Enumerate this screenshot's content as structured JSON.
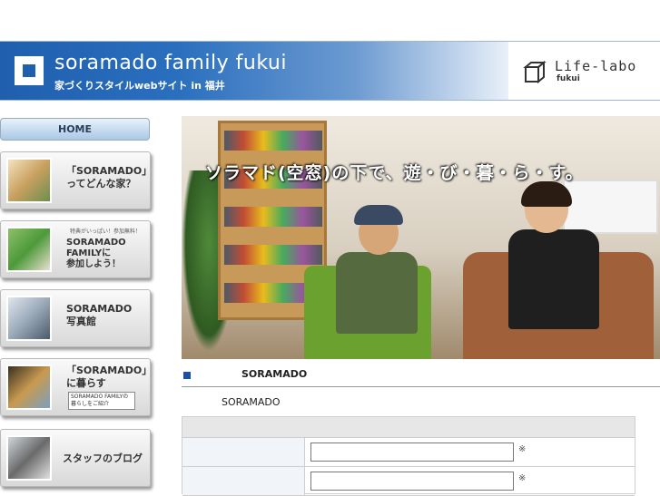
{
  "header": {
    "site_title": "soramado family fukui",
    "site_subtitle": "家づくりスタイルwebサイト in 福井",
    "brand_name": "Life-labo",
    "brand_sub": "fukui"
  },
  "sidebar": {
    "home_label": "HOME",
    "items": [
      {
        "label": "「SORAMADO」\nってどんな家？"
      },
      {
        "small": "特典がいっぱい！参加無料！",
        "label": "SORAMADO\nFAMILYに\n参加しよう！"
      },
      {
        "label": "SORAMADO\n写真館"
      },
      {
        "label": "「SORAMADO」\nに暮らす",
        "small_box": "SORAMADO FAMILYの\n暮らしをご紹介"
      },
      {
        "label": "スタッフのブログ"
      }
    ]
  },
  "hero": {
    "caption": "ソラマド(空窓)の下で、遊・び・暮・ら・す。"
  },
  "section": {
    "title": "SORAMADO",
    "text": "SORAMADO"
  },
  "form": {
    "rows": [
      {
        "label": "",
        "value": "",
        "required_mark": "※"
      },
      {
        "label": "",
        "value": "",
        "required_mark": "※"
      }
    ]
  },
  "colors": {
    "header_blue": "#1f5fae",
    "accent_blue": "#1f4fa0"
  }
}
